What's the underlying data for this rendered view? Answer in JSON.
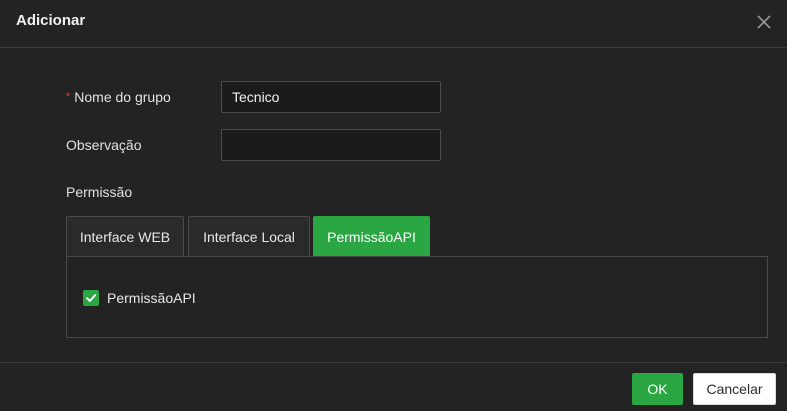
{
  "dialog": {
    "title": "Adicionar",
    "close_icon": "close-icon"
  },
  "form": {
    "group_name": {
      "required_mark": "*",
      "label": "Nome do grupo",
      "value": "Tecnico"
    },
    "observation": {
      "label": "Observação",
      "value": ""
    },
    "permission_label": "Permissão"
  },
  "tabs": [
    {
      "label": "Interface WEB",
      "active": false
    },
    {
      "label": "Interface Local",
      "active": false
    },
    {
      "label": "PermissãoAPI",
      "active": true
    }
  ],
  "panel": {
    "checkbox_label": "PermissãoAPI",
    "checked": true,
    "check_icon": "check-icon"
  },
  "footer": {
    "ok_label": "OK",
    "cancel_label": "Cancelar"
  },
  "colors": {
    "accent": "#2aa642",
    "background": "#232323",
    "required": "#e04343"
  }
}
